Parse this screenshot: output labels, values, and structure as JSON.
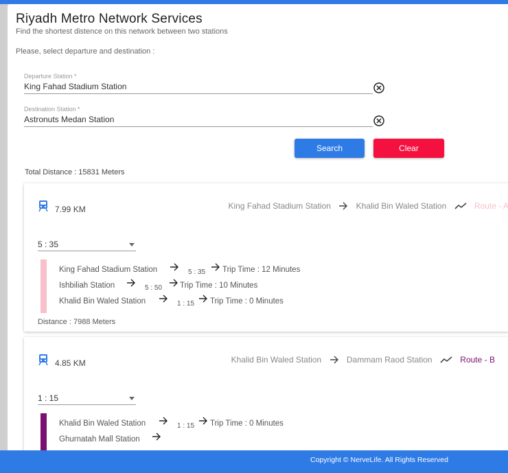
{
  "header": {
    "title": "Riyadh Metro Network Services",
    "subtitle": "Find the shortest distence on this network between two stations",
    "prompt": "Please, select departure and destination :"
  },
  "form": {
    "departure": {
      "label": "Departure Station *",
      "value": "King Fahad Stadium Station"
    },
    "destination": {
      "label": "Destination Station *",
      "value": "Astronuts Medan Station"
    },
    "search_label": "Search",
    "clear_label": "Clear"
  },
  "total_distance": "Total Distance : 15831 Meters",
  "routes": [
    {
      "km": "7.99 KM",
      "from": "King Fahad Stadium Station",
      "to": "Khalid Bin Waled Station",
      "route_label": "Route - A",
      "route_color": "#f7c0ca",
      "selected_time": "5 : 35",
      "stops": [
        {
          "name": "King Fahad Stadium Station",
          "time": "5 : 35",
          "trip": "Trip Time : 12 Minutes"
        },
        {
          "name": "Ishbiliah Station",
          "time": "5 : 50",
          "trip": "Trip Time : 10 Minutes"
        },
        {
          "name": "Khalid Bin Waled Station",
          "time": "1 : 15",
          "trip": "Trip Time : 0 Minutes"
        }
      ],
      "distance": "Distance : 7988 Meters"
    },
    {
      "km": "4.85 KM",
      "from": "Khalid Bin Waled Station",
      "to": "Dammam Raod Station",
      "route_label": "Route - B",
      "route_color": "#7b0f72",
      "selected_time": "1 : 15",
      "stops": [
        {
          "name": "Khalid Bin Waled Station",
          "time": "1 : 15",
          "trip": "Trip Time : 0 Minutes"
        },
        {
          "name": "Ghurnatah Mall Station"
        }
      ]
    }
  ],
  "footer": {
    "text": "Copyright © NerveLife. All Rights Reserved"
  },
  "colors": {
    "primary": "#2f7be6",
    "danger": "#f4103f",
    "metro_icon": "#2f7be6"
  },
  "icons": {
    "clear_field": "circle-x-icon",
    "train": "train-icon",
    "arrow": "arrow-right-icon",
    "route": "trending-icon"
  }
}
